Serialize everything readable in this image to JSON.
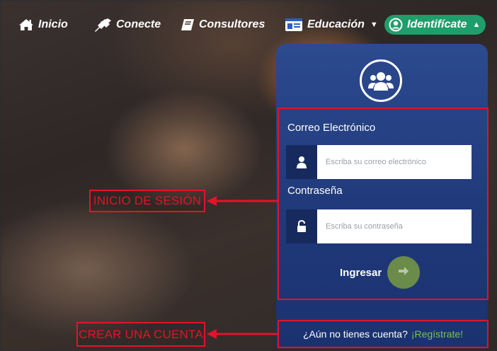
{
  "nav": {
    "inicio": "Inicio",
    "conecte": "Conecte",
    "consultores": "Consultores",
    "educacion": "Educación",
    "identificate": "Identifícate"
  },
  "login": {
    "email_label": "Correo Electrónico",
    "email_placeholder": "Escriba su correo electrónico",
    "password_label": "Contraseña",
    "password_placeholder": "Escriba su contraseña",
    "submit_label": "Ingresar"
  },
  "register": {
    "question": "¿Aún no tienes cuenta?",
    "link": "¡Regístrate!"
  },
  "annotations": {
    "login": "INICIO DE SESIÓN",
    "register": "CREAR UNA CUENTA"
  },
  "icons": {
    "home": "home-icon",
    "plug": "plug-icon",
    "book": "book-icon",
    "id_card": "id-card-icon",
    "user_circle": "user-circle-icon",
    "users": "users-icon",
    "user": "user-icon",
    "unlock": "unlock-icon",
    "arrow_right": "arrow-right-icon"
  },
  "colors": {
    "panel": "#20397a",
    "identificate_bg": "#1e9e6a",
    "highlight": "#e3132a",
    "register_link": "#7cc246",
    "submit_button": "#6b8b4a"
  }
}
